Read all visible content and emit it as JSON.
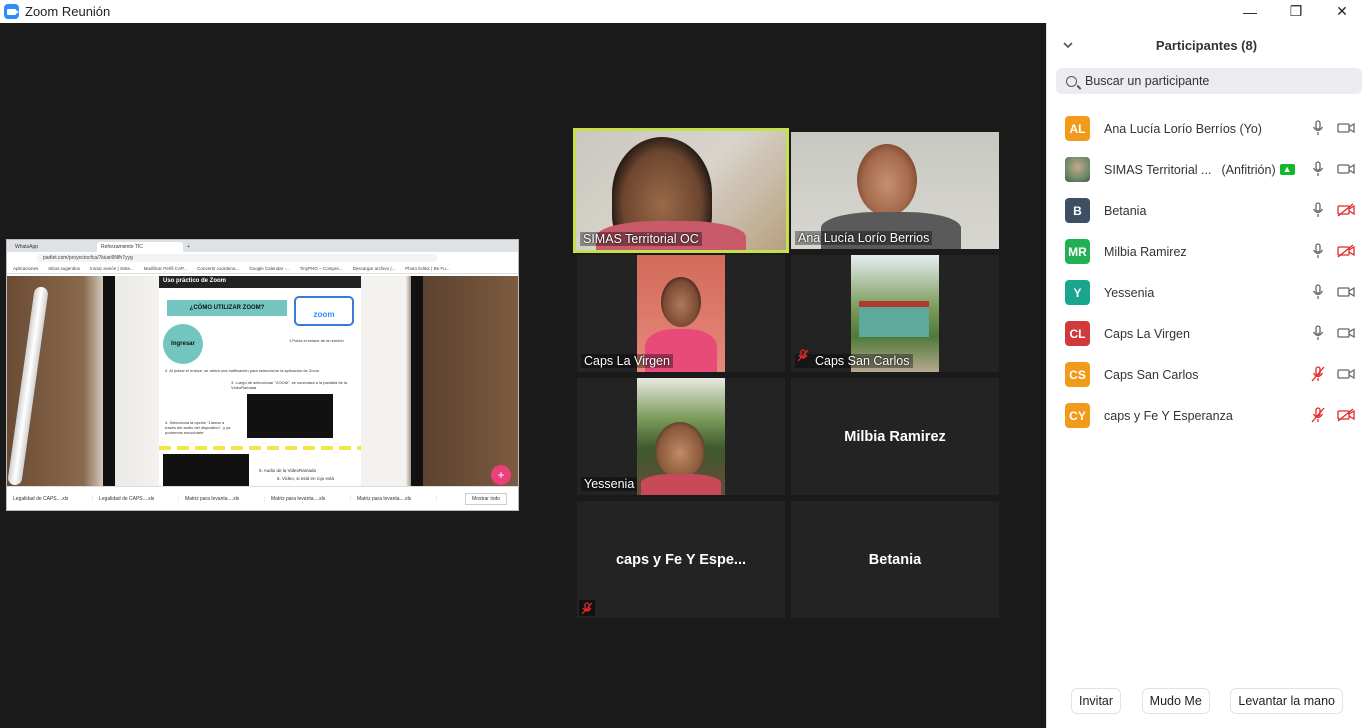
{
  "window": {
    "title": "Zoom Reunión",
    "minimize": "—",
    "restore": "❐",
    "close": "✕"
  },
  "shared_screen": {
    "tabs": [
      "WhatsApp",
      "Reforzamiento TIC"
    ],
    "new_tab": "+",
    "url": "padlet.com/proyectocfca/7kiuei9Nfh7yyg",
    "bookmarks": [
      "Aplicaciones",
      "Sitios sugeridos",
      "Iniciar sesión | Siste...",
      "Modificar Perfil CAP...",
      "Convertir coordena...",
      "Google Calendar -...",
      "TinyPNG – Compre...",
      "Descargar archivo |...",
      "Photo Editor | Be Fu..."
    ],
    "doc_header": "Uso práctico de Zoom",
    "doc_heading": "¿CÓMO UTILIZAR ZOOM?",
    "zoom_logo": "zoom",
    "ingresar": "Ingresar",
    "steps": [
      "1.Pulsa el enlace de la reunión",
      "2. Al pulsar el enlace, se abrirá una notificación para seleccionar la aplicación de Zoom",
      "3. Luego de seleccionar \"ZOOM\", se conectará a la pantalla de la VideoRamada",
      "4. Selecciona la opción \"Llamar a través del audio del dispositivo\", y ya podremos escucharte",
      "5. Audio de la VideoRamada",
      "6. Vídeo, si está en rojo está"
    ],
    "fab": "+",
    "downloads": [
      "Legalidad de CAPS....xls",
      "Legalidad de CAPS....xls",
      "Matriz para levanta....xls",
      "Matriz para levanta....xls",
      "Matriz para levanta....xls"
    ],
    "show_all": "Mostrar todo"
  },
  "video_tiles": [
    {
      "name": "SIMAS Territorial OC",
      "active": true,
      "muted": false
    },
    {
      "name": "Ana Lucía Lorío Berrios",
      "active": false,
      "muted": false
    },
    {
      "name": "Caps La Virgen",
      "active": false,
      "muted": false
    },
    {
      "name": "Caps San Carlos",
      "active": false,
      "muted": true
    },
    {
      "name": "Yessenia",
      "active": false,
      "muted": false
    },
    {
      "name": "Milbia Ramirez",
      "active": false,
      "muted": false
    },
    {
      "name": "caps y Fe Y Espe...",
      "active": false,
      "muted": true
    },
    {
      "name": "Betania",
      "active": false,
      "muted": false
    }
  ],
  "participants_panel": {
    "title": "Participantes (8)",
    "search_placeholder": "Buscar un participante",
    "participants": [
      {
        "initials": "AL",
        "name": "Ana Lucía Lorío Berríos (Yo)",
        "extra": "",
        "color": "#f29a1a",
        "mic_muted": false,
        "video_off": false,
        "photo": false
      },
      {
        "initials": "",
        "name": "SIMAS Territorial ...",
        "extra": "(Anfitrión)",
        "color": "#7aa07a",
        "mic_muted": false,
        "video_off": false,
        "photo": true
      },
      {
        "initials": "B",
        "name": "Betania",
        "extra": "",
        "color": "#3d4f63",
        "mic_muted": false,
        "video_off": true,
        "photo": false
      },
      {
        "initials": "MR",
        "name": "Milbia Ramirez",
        "extra": "",
        "color": "#23b055",
        "mic_muted": false,
        "video_off": true,
        "photo": false
      },
      {
        "initials": "Y",
        "name": "Yessenia",
        "extra": "",
        "color": "#1aa58f",
        "mic_muted": false,
        "video_off": false,
        "photo": false
      },
      {
        "initials": "CL",
        "name": "Caps La Virgen",
        "extra": "",
        "color": "#d13a3a",
        "mic_muted": false,
        "video_off": false,
        "photo": false
      },
      {
        "initials": "CS",
        "name": "Caps San Carlos",
        "extra": "",
        "color": "#f29a1a",
        "mic_muted": true,
        "video_off": false,
        "photo": false
      },
      {
        "initials": "CY",
        "name": "caps y Fe Y Esperanza",
        "extra": "",
        "color": "#f29a1a",
        "mic_muted": true,
        "video_off": true,
        "photo": false
      }
    ],
    "buttons": {
      "invite": "Invitar",
      "mute_me": "Mudo Me",
      "raise_hand": "Levantar la mano"
    }
  },
  "colors": {
    "active_speaker_border": "#c4e04c",
    "muted_red": "#e02828",
    "zoom_blue": "#2d8cff"
  }
}
